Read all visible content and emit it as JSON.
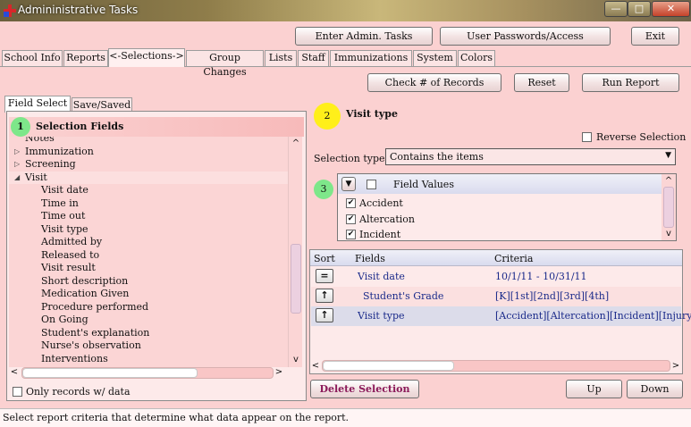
{
  "window": {
    "title": "Admininistrative Tasks",
    "min_glyph": "—",
    "max_glyph": "□",
    "close_glyph": "✕"
  },
  "top_buttons": {
    "enter_admin": "Enter Admin. Tasks",
    "user_passwords": "User Passwords/Access",
    "exit": "Exit"
  },
  "tabs": [
    "School Info",
    "Reports",
    "<-Selections->",
    "Group Changes",
    "Lists",
    "Staff",
    "Immunizations",
    "System",
    "Colors"
  ],
  "action_buttons": {
    "check_records": "Check # of Records",
    "reset": "Reset",
    "run_report": "Run Report"
  },
  "left_panel": {
    "subtabs": [
      "Field Select",
      "Save/Saved"
    ],
    "step": "1",
    "heading": "Selection Fields",
    "tree": [
      {
        "label": "Notes",
        "level": 0,
        "expander": ""
      },
      {
        "label": "Immunization",
        "level": 0,
        "expander": "▷"
      },
      {
        "label": "Screening",
        "level": 0,
        "expander": "▷"
      },
      {
        "label": "Visit",
        "level": 0,
        "expander": "◢"
      },
      {
        "label": "Visit date",
        "level": 1,
        "expander": ""
      },
      {
        "label": "Time in",
        "level": 1,
        "expander": ""
      },
      {
        "label": "Time out",
        "level": 1,
        "expander": ""
      },
      {
        "label": "Visit type",
        "level": 1,
        "expander": ""
      },
      {
        "label": "Admitted by",
        "level": 1,
        "expander": ""
      },
      {
        "label": "Released to",
        "level": 1,
        "expander": ""
      },
      {
        "label": "Visit result",
        "level": 1,
        "expander": ""
      },
      {
        "label": "Short description",
        "level": 1,
        "expander": ""
      },
      {
        "label": "Medication Given",
        "level": 1,
        "expander": ""
      },
      {
        "label": "Procedure performed",
        "level": 1,
        "expander": ""
      },
      {
        "label": "On Going",
        "level": 1,
        "expander": ""
      },
      {
        "label": "Student's explanation",
        "level": 1,
        "expander": ""
      },
      {
        "label": "Nurse's observation",
        "level": 1,
        "expander": ""
      },
      {
        "label": "Interventions",
        "level": 1,
        "expander": ""
      }
    ],
    "only_records_label": "Only records w/ data",
    "scroll_up": "^",
    "scroll_down": "v",
    "scroll_left": "<",
    "scroll_right": ">"
  },
  "detail": {
    "step": "2",
    "field_name": "Visit type",
    "reverse_label": "Reverse Selection",
    "selection_type_label": "Selection type",
    "selection_type_value": "Contains the items",
    "dropdown_arrow": "▼"
  },
  "field_values": {
    "step": "3",
    "header": "Field Values",
    "toggle_glyph": "▼",
    "items": [
      {
        "label": "Accident",
        "checked": true
      },
      {
        "label": "Altercation",
        "checked": true
      },
      {
        "label": "Incident",
        "checked": true
      }
    ],
    "scroll_up": "^",
    "scroll_down": "v"
  },
  "criteria_grid": {
    "columns": [
      "Sort",
      "Fields",
      "Criteria"
    ],
    "rows": [
      {
        "sort_glyph": "=",
        "field": "Visit date",
        "criteria": "10/1/11 - 10/31/11"
      },
      {
        "sort_glyph": "↑",
        "field": "Student's Grade",
        "criteria": "[K][1st][2nd][3rd][4th]"
      },
      {
        "sort_glyph": "↑",
        "field": "Visit type",
        "criteria": "[Accident][Altercation][Incident][Injury]"
      }
    ],
    "scroll_left": "<",
    "scroll_right": ">"
  },
  "bottom_buttons": {
    "delete_selection": "Delete Selection",
    "up": "Up",
    "down": "Down"
  },
  "status": "Select report criteria that determine what data appear on the report.",
  "colors": {
    "panel_pink": "#fbd1d1",
    "step1_green": "#7ee78a",
    "step2_yellow": "#ffef1a",
    "link_blue": "#1a2a8a",
    "delete_text": "#8a1a5a"
  }
}
